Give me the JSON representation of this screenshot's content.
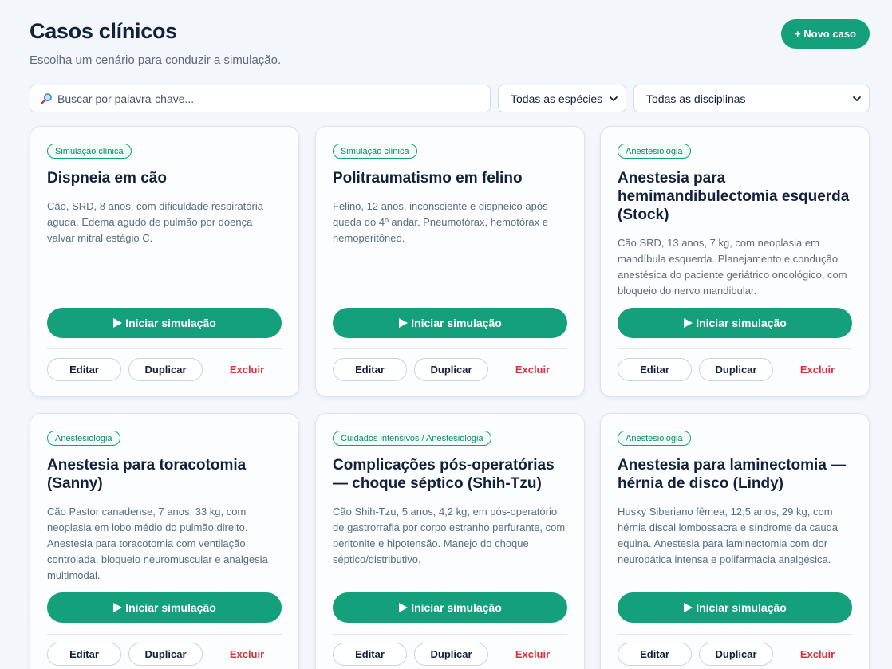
{
  "header": {
    "title": "Casos clínicos",
    "subtitle": "Escolha um cenário para conduzir a simulação.",
    "new_case_label": "+ Novo caso"
  },
  "filters": {
    "search_placeholder": "Buscar por palavra-chave...",
    "search_value": "",
    "search_icon": "search-icon",
    "species_selected": "Todas as espécies",
    "discipline_selected": "Todas as disciplinas"
  },
  "colors": {
    "accent": "#14a07b",
    "danger": "#d8343f",
    "background": "#f3f6fb"
  },
  "card_actions": {
    "start": "Iniciar simulação",
    "edit": "Editar",
    "duplicate": "Duplicar",
    "delete": "Excluir"
  },
  "cases": [
    {
      "tag": "Simulação clínica",
      "title": "Dispneia em cão",
      "description": "Cão, SRD, 8 anos, com dificuldade respiratória aguda. Edema agudo de pulmão por doença valvar mitral estágio C."
    },
    {
      "tag": "Simulação clínica",
      "title": "Politraumatismo em felino",
      "description": "Felino, 12 anos, inconsciente e dispneico após queda do 4º andar. Pneumotórax, hemotórax e hemoperitôneo."
    },
    {
      "tag": "Anestesiologia",
      "title": "Anestesia para hemimandibulectomia esquerda (Stock)",
      "description": "Cão SRD, 13 anos, 7 kg, com neoplasia em mandíbula esquerda. Planejamento e condução anestésica do paciente geriátrico oncológico, com bloqueio do nervo mandibular."
    },
    {
      "tag": "Anestesiologia",
      "title": "Anestesia para toracotomia (Sanny)",
      "description": "Cão Pastor canadense, 7 anos, 33 kg, com neoplasia em lobo médio do pulmão direito. Anestesia para toracotomia com ventilação controlada, bloqueio neuromuscular e analgesia multimodal."
    },
    {
      "tag": "Cuidados intensivos / Anestesiologia",
      "title": "Complicações pós-operatórias — choque séptico (Shih-Tzu)",
      "description": "Cão Shih-Tzu, 5 anos, 4,2 kg, em pós-operatório de gastrorrafia por corpo estranho perfurante, com peritonite e hipotensão. Manejo do choque séptico/distributivo."
    },
    {
      "tag": "Anestesiologia",
      "title": "Anestesia para laminectomia — hérnia de disco (Lindy)",
      "description": "Husky Siberiano fêmea, 12,5 anos, 29 kg, com hérnia discal lombossacra e síndrome da cauda equina. Anestesia para laminectomia com dor neuropática intensa e polifarmácia analgésica."
    }
  ]
}
